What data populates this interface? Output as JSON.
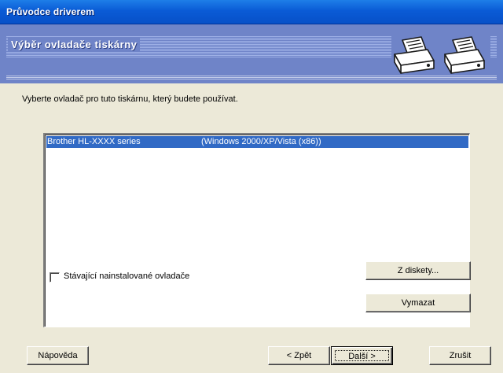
{
  "window": {
    "title": "Průvodce driverem"
  },
  "header": {
    "heading": "Výběr ovladače tiskárny",
    "icons": [
      "printer-icon",
      "printer-icon"
    ]
  },
  "main": {
    "instruction": "Vyberte ovladač pro tuto tiskárnu, který budete používat.",
    "driver_list": [
      {
        "name": "Brother HL-XXXX series",
        "platform": "(Windows 2000/XP/Vista (x86))",
        "selected": true
      }
    ],
    "checkbox": {
      "label": "Stávající nainstalované ovladače",
      "checked": false
    },
    "buttons": {
      "diskety": "Z diskety...",
      "vymazat": "Vymazat"
    }
  },
  "footer": {
    "help": "Nápověda",
    "back": "< Zpět",
    "next": "Další >",
    "cancel": "Zrušit"
  },
  "colors": {
    "title_bar": "#0a5bd6",
    "header_band": "#6f84c8",
    "selection": "#316ac5",
    "dialog_face": "#ece9d8"
  }
}
